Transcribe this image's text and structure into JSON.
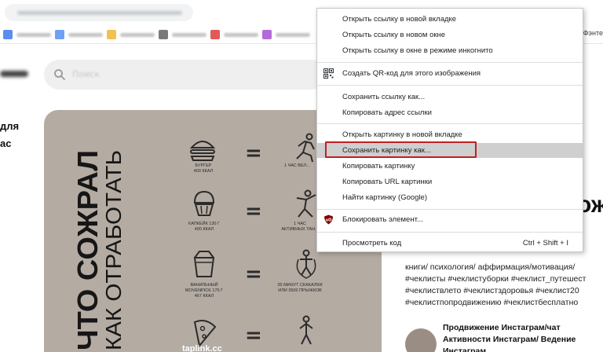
{
  "browser": {
    "right_bookmark": "Фэнте"
  },
  "site": {
    "left_text": [
      "для",
      "ас"
    ],
    "search_placeholder": "Поиск"
  },
  "pin": {
    "title_main": "ЧТО СОЖРАЛ",
    "title_sub": "КАК ОТРАБОТАТЬ",
    "rows": [
      {
        "food": "БУРГЕР\n400 ККАЛ",
        "activity": "1 ЧАС ВЕЛ..."
      },
      {
        "food": "КАПКЕЙК 130 Г\n400 ККАЛ",
        "activity": "1 ЧАС\nАКТИВНЫХ ТАН..."
      },
      {
        "food": "ВАНИЛЬНЫЙ\nMOVENPICK 175 Г\n467 ККАЛ",
        "activity": "35 МИНУТ СКАКАЛКИ\nИЛИ 3500 ПРЫЖКОВ"
      },
      {
        "food": "",
        "activity": ""
      }
    ],
    "footer": "taplink.cc"
  },
  "right": {
    "big_title": "ож",
    "description_lines": [
      "книги/ психология/ аффирмация/мотивация/",
      "#чеклисты #чеклистуборки #чеклист_путешест",
      "#чеклиствлето #чеклистздоровья #чеклист20",
      "#чеклистпопродвижению #чеклистбесплатно"
    ],
    "board_title": "Продвижение Инстаграм/чат Активности Инстаграм/ Ведение Инстаграм"
  },
  "context_menu": {
    "groups": [
      [
        {
          "label": "Открыть ссылку в новой вкладке"
        },
        {
          "label": "Открыть ссылку в новом окне"
        },
        {
          "label": "Открыть ссылку в окне в режиме инкогнито"
        }
      ],
      [
        {
          "label": "Создать QR-код для этого изображения",
          "icon": "qr-code-icon"
        }
      ],
      [
        {
          "label": "Сохранить ссылку как..."
        },
        {
          "label": "Копировать адрес ссылки"
        }
      ],
      [
        {
          "label": "Открыть картинку в новой вкладке"
        },
        {
          "label": "Сохранить картинку как...",
          "highlighted": true
        },
        {
          "label": "Копировать картинку"
        },
        {
          "label": "Копировать URL картинки"
        },
        {
          "label": "Найти картинку (Google)"
        }
      ],
      [
        {
          "label": "Блокировать элемент...",
          "icon": "ublock-icon"
        }
      ],
      [
        {
          "label": "Просмотреть код",
          "shortcut": "Ctrl + Shift + I"
        }
      ]
    ]
  },
  "colors": {
    "highlight": "#cfcfcf",
    "annotation_box": "#c0201f",
    "pin_background": "#b4aba3",
    "ublock_red": "#800000"
  }
}
